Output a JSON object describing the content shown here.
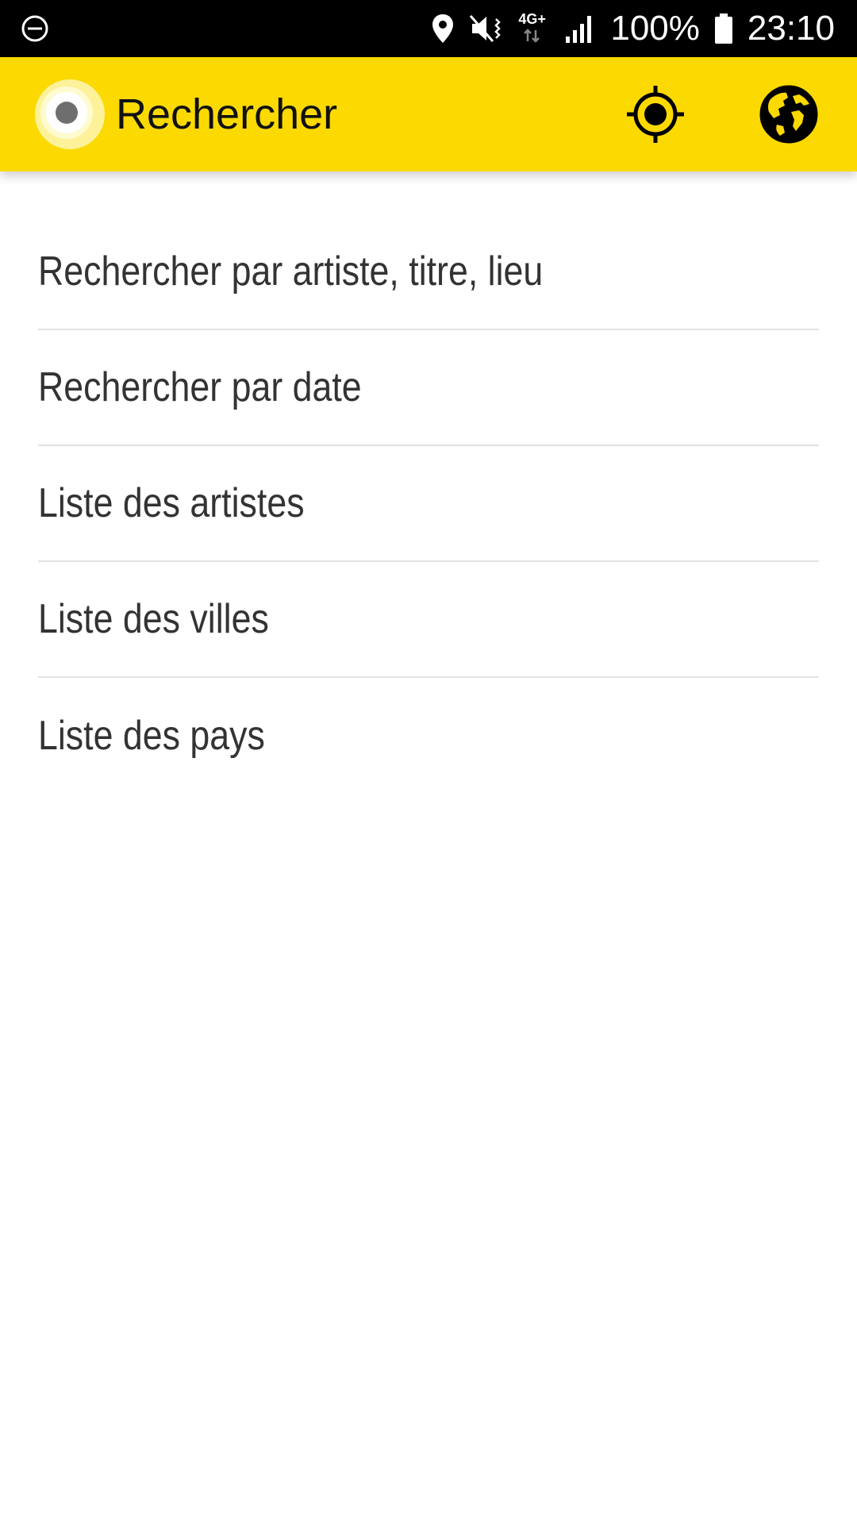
{
  "status_bar": {
    "battery_percent": "100%",
    "time": "23:10",
    "network_type": "4G+",
    "icons": [
      "do-not-disturb-icon",
      "location-icon",
      "mute-vibrate-icon",
      "network-4g-icon",
      "signal-icon",
      "battery-icon"
    ]
  },
  "app_bar": {
    "title": "Rechercher",
    "logo_icon": "app-logo-icon",
    "actions": [
      {
        "icon": "locate-icon"
      },
      {
        "icon": "globe-icon"
      }
    ],
    "background_color": "#fcd900"
  },
  "menu": {
    "items": [
      {
        "label": "Rechercher par artiste, titre, lieu"
      },
      {
        "label": "Rechercher par date"
      },
      {
        "label": "Liste des artistes"
      },
      {
        "label": "Liste des villes"
      },
      {
        "label": "Liste des pays"
      }
    ]
  }
}
